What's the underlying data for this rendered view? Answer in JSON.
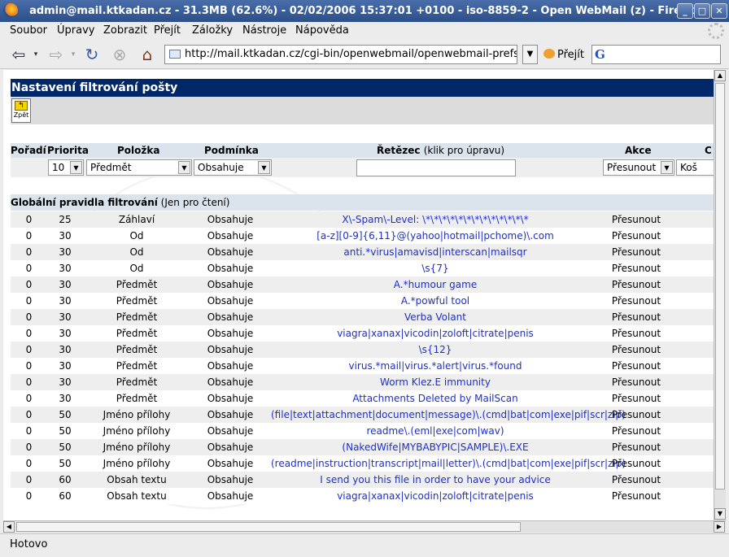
{
  "window": {
    "title": "admin@mail.ktkadan.cz - 31.3MB (62.6%) - 02/02/2006 15:37:01 +0100 - iso-8859-2 - Open WebMail (z) - Firefox"
  },
  "menu": [
    "Soubor",
    "Úpravy",
    "Zobrazit",
    "Přejít",
    "Záložky",
    "Nástroje",
    "Nápověda"
  ],
  "nav": {
    "url": "http://mail.ktkadan.cz/cgi-bin/openwebmail/openwebmail-prefs.pl?actio",
    "go_label": "Přejít",
    "search_logo": "G"
  },
  "page": {
    "heading": "Nastavení filtrování pošty",
    "back_label": "Zpět"
  },
  "columns": {
    "order": "Pořadí",
    "priority": "Priorita",
    "item": "Položka",
    "condition": "Podmínka",
    "string": "Řetězec",
    "string_hint": "(klik pro úpravu)",
    "action": "Akce",
    "dest": "C"
  },
  "inputs": {
    "priority": "10",
    "item": "Předmět",
    "condition": "Obsahuje",
    "action": "Přesunout",
    "dest": "Koš"
  },
  "global": {
    "title": "Globální pravidla filtrování",
    "subtitle": "(Jen pro čtení)"
  },
  "rules": [
    {
      "order": "0",
      "priority": "25",
      "item": "Záhlaví",
      "condition": "Obsahuje",
      "string": "X\\-Spam\\-Level: \\*\\*\\*\\*\\*\\*\\*\\*\\*\\*\\*\\*\\*",
      "action": "Přesunout"
    },
    {
      "order": "0",
      "priority": "30",
      "item": "Od",
      "condition": "Obsahuje",
      "string": "[a-z][0-9]{6,11}@(yahoo|hotmail|pchome)\\.com",
      "action": "Přesunout"
    },
    {
      "order": "0",
      "priority": "30",
      "item": "Od",
      "condition": "Obsahuje",
      "string": "anti.*virus|amavisd|interscan|mailsqr",
      "action": "Přesunout"
    },
    {
      "order": "0",
      "priority": "30",
      "item": "Od",
      "condition": "Obsahuje",
      "string": "\\s{7}",
      "action": "Přesunout"
    },
    {
      "order": "0",
      "priority": "30",
      "item": "Předmět",
      "condition": "Obsahuje",
      "string": "A.*humour game",
      "action": "Přesunout"
    },
    {
      "order": "0",
      "priority": "30",
      "item": "Předmět",
      "condition": "Obsahuje",
      "string": "A.*powful tool",
      "action": "Přesunout"
    },
    {
      "order": "0",
      "priority": "30",
      "item": "Předmět",
      "condition": "Obsahuje",
      "string": "Verba Volant",
      "action": "Přesunout"
    },
    {
      "order": "0",
      "priority": "30",
      "item": "Předmět",
      "condition": "Obsahuje",
      "string": "viagra|xanax|vicodin|zoloft|citrate|penis",
      "action": "Přesunout"
    },
    {
      "order": "0",
      "priority": "30",
      "item": "Předmět",
      "condition": "Obsahuje",
      "string": "\\s{12}",
      "action": "Přesunout"
    },
    {
      "order": "0",
      "priority": "30",
      "item": "Předmět",
      "condition": "Obsahuje",
      "string": "virus.*mail|virus.*alert|virus.*found",
      "action": "Přesunout"
    },
    {
      "order": "0",
      "priority": "30",
      "item": "Předmět",
      "condition": "Obsahuje",
      "string": "Worm Klez.E immunity",
      "action": "Přesunout"
    },
    {
      "order": "0",
      "priority": "30",
      "item": "Předmět",
      "condition": "Obsahuje",
      "string": "Attachments Deleted by MailScan",
      "action": "Přesunout"
    },
    {
      "order": "0",
      "priority": "50",
      "item": "Jméno přílohy",
      "condition": "Obsahuje",
      "string": "(file|text|attachment|document|message)\\.(cmd|bat|com|exe|pif|scr|zip)",
      "action": "Přesunout"
    },
    {
      "order": "0",
      "priority": "50",
      "item": "Jméno přílohy",
      "condition": "Obsahuje",
      "string": "readme\\.(eml|exe|com|wav)",
      "action": "Přesunout"
    },
    {
      "order": "0",
      "priority": "50",
      "item": "Jméno přílohy",
      "condition": "Obsahuje",
      "string": "(NakedWife|MYBABYPIC|SAMPLE)\\.EXE",
      "action": "Přesunout"
    },
    {
      "order": "0",
      "priority": "50",
      "item": "Jméno přílohy",
      "condition": "Obsahuje",
      "string": "(readme|instruction|transcript|mail|letter)\\.(cmd|bat|com|exe|pif|scr|zip)",
      "action": "Přesunout"
    },
    {
      "order": "0",
      "priority": "60",
      "item": "Obsah textu",
      "condition": "Obsahuje",
      "string": "I send you this file in order to have your advice",
      "action": "Přesunout"
    },
    {
      "order": "0",
      "priority": "60",
      "item": "Obsah textu",
      "condition": "Obsahuje",
      "string": "viagra|xanax|vicodin|zoloft|citrate|penis",
      "action": "Přesunout"
    }
  ],
  "status": "Hotovo",
  "colors": {
    "header_bg": "#002868",
    "link": "#1d2fcc",
    "stripe": "#eeeeee",
    "section_bg": "#dbe4ec"
  }
}
